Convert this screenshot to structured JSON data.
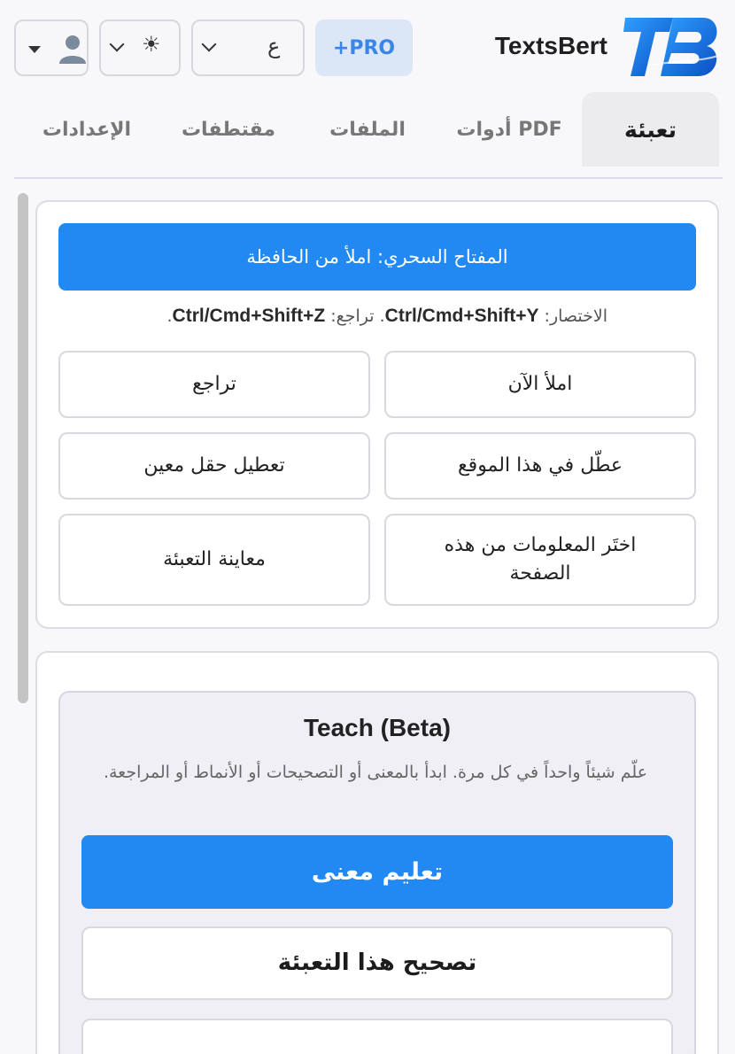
{
  "header": {
    "brand": "TextsBert",
    "pro_label": "+PRO",
    "lang_value": "ع",
    "theme_icon": "☀",
    "profile_icon": "person-icon"
  },
  "tabs": [
    {
      "label": "تعبئة",
      "active": true
    },
    {
      "label": "أدوات PDF",
      "active": false
    },
    {
      "label": "الملفات",
      "active": false
    },
    {
      "label": "مقتطفات",
      "active": false
    },
    {
      "label": "الإعدادات",
      "active": false
    }
  ],
  "fill_card": {
    "magic_button": "المفتاح السحري: املأ من الحافظة",
    "shortcut_prefix": "الاختصار: ",
    "shortcut_fill": "Ctrl/Cmd+Shift+Y",
    "shortcut_mid": ". تراجع: ",
    "shortcut_undo": "Ctrl/Cmd+Shift+Z",
    "shortcut_end": ".",
    "fill_now": "املأ الآن",
    "undo": "تراجع",
    "disable_site": "عطّل في هذا الموقع",
    "disable_field": "تعطيل حقل معين",
    "pick_info": "اختَر المعلومات من هذه الصفحة",
    "preview_fill": "معاينة التعبئة"
  },
  "teach": {
    "title": "Teach (Beta)",
    "description": "علّم شيئاً واحداً في كل مرة. ابدأ بالمعنى أو التصحيحات أو الأنماط أو المراجعة.",
    "teach_meaning": "تعليم معنى",
    "correct_fill": "تصحيح هذا التعبئة"
  },
  "colors": {
    "accent": "#2288f2",
    "pro_bg": "#dbe6f6",
    "pro_text": "#3a86e8"
  }
}
